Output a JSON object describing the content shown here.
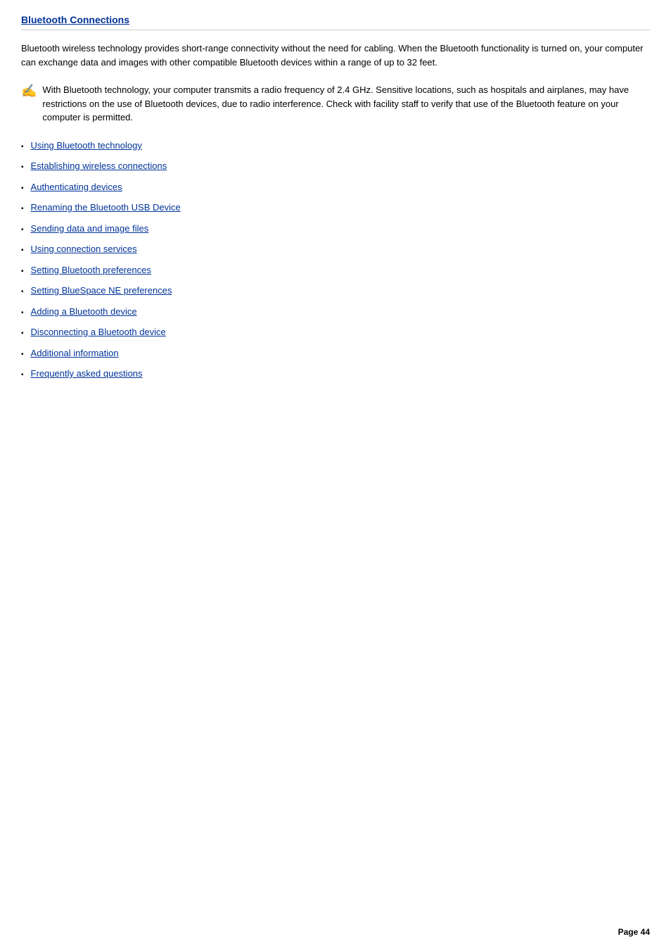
{
  "page": {
    "title": "Bluetooth Connections",
    "intro": "Bluetooth   wireless technology provides short-range connectivity without the need for cabling. When the Bluetooth functionality is turned on, your computer can exchange data and images with other compatible Bluetooth devices within a range of up to 32 feet.",
    "note": "With Bluetooth technology, your computer transmits a radio frequency of 2.4 GHz. Sensitive locations, such as hospitals and airplanes, may have restrictions on the use of Bluetooth devices, due to radio interference. Check with facility staff to verify that use of the Bluetooth feature on your computer is permitted.",
    "note_icon": "✍",
    "links": [
      "Using Bluetooth technology",
      "Establishing wireless connections",
      "Authenticating devices",
      "Renaming the Bluetooth USB Device",
      "Sending data and image files",
      "Using connection services",
      "Setting Bluetooth preferences",
      "Setting BlueSpace NE preferences",
      "Adding a Bluetooth device",
      "Disconnecting a Bluetooth device",
      "Additional information",
      "Frequently asked questions"
    ],
    "page_number": "Page 44"
  }
}
